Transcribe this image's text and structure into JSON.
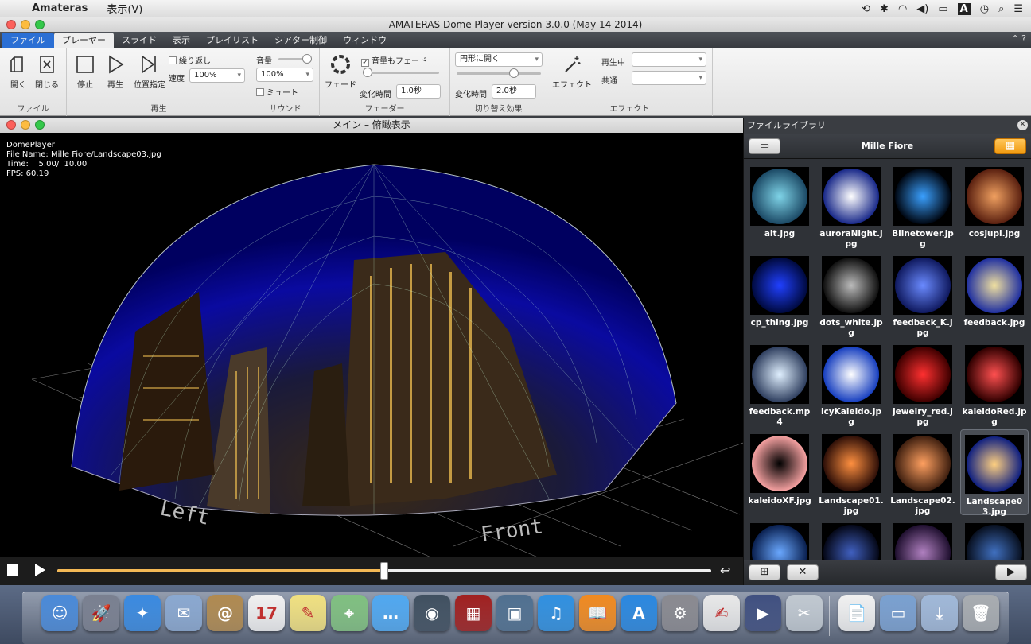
{
  "menubar": {
    "app": "Amateras",
    "menu": "表示(V)",
    "status_icons": [
      "time-machine-icon",
      "bluetooth-icon",
      "wifi-icon",
      "volume-icon",
      "battery-icon",
      "input-source-icon",
      "clock-icon",
      "spotlight-icon",
      "notification-icon"
    ],
    "input_source": "A"
  },
  "window_title": "AMATERAS Dome Player version 3.0.0 (May 14 2014)",
  "tabs": [
    "ファイル",
    "プレーヤー",
    "スライド",
    "表示",
    "プレイリスト",
    "シアター制御",
    "ウィンドウ"
  ],
  "ribbon": {
    "file": {
      "open": "開く",
      "close": "閉じる",
      "label": "ファイル"
    },
    "play": {
      "stop": "停止",
      "play": "再生",
      "position": "位置指定",
      "repeat": "繰り返し",
      "speed_label": "速度",
      "speed_value": "100%",
      "label": "再生"
    },
    "sound": {
      "volume_label": "音量",
      "volume_value": "100%",
      "mute": "ミュート",
      "label": "サウンド"
    },
    "fader": {
      "fade": "フェード",
      "volume_fade": "音量もフェード",
      "time_label": "変化時間",
      "time_value": "1.0秒",
      "label": "フェーダー"
    },
    "transition": {
      "mode": "円形に開く",
      "time_label": "変化時間",
      "time_value": "2.0秒",
      "label": "切り替え効果"
    },
    "effect": {
      "effect": "エフェクト",
      "playing_label": "再生中",
      "common_label": "共通",
      "label": "エフェクト"
    }
  },
  "main_window": {
    "title": "メイン – 俯瞰表示",
    "overlay": "DomePlayer\nFile Name: Mille Fiore/Landscape03.jpg\nTime:    5.00/  10.00\nFPS: 60.19",
    "labels": {
      "left": "Left",
      "front": "Front"
    },
    "progress": 0.5
  },
  "library": {
    "title": "ファイルライブラリ",
    "folder": "Mille Fiore",
    "items": [
      {
        "name": "alt.jpg",
        "colors": [
          "#7fd4e8",
          "#1c4a66"
        ]
      },
      {
        "name": "auroraNight.jpg",
        "colors": [
          "#ffffff",
          "#1a2a8a"
        ]
      },
      {
        "name": "Blinetower.jpg",
        "colors": [
          "#3aa0ff",
          "#000814"
        ]
      },
      {
        "name": "cosjupi.jpg",
        "colors": [
          "#f0a060",
          "#5a2010"
        ]
      },
      {
        "name": "cp_thing.jpg",
        "colors": [
          "#2040ff",
          "#000a40"
        ]
      },
      {
        "name": "dots_white.jpg",
        "colors": [
          "#bbbbbb",
          "#111111"
        ]
      },
      {
        "name": "feedback_K.jpg",
        "colors": [
          "#6a8aff",
          "#101a60"
        ]
      },
      {
        "name": "feedback.jpg",
        "colors": [
          "#f0e0a0",
          "#2030a0"
        ]
      },
      {
        "name": "feedback.mp4",
        "colors": [
          "#e0f0ff",
          "#304060"
        ]
      },
      {
        "name": "icyKaleido.jpg",
        "colors": [
          "#ffffff",
          "#1840c0"
        ]
      },
      {
        "name": "jewelry_red.jpg",
        "colors": [
          "#ff3030",
          "#400000"
        ]
      },
      {
        "name": "kaleidoRed.jpg",
        "colors": [
          "#ff5050",
          "#300000"
        ]
      },
      {
        "name": "kaleidoXF.jpg",
        "colors": [
          "#000000",
          "#f4a0a0"
        ]
      },
      {
        "name": "Landscape01.jpg",
        "colors": [
          "#ff9040",
          "#301008"
        ]
      },
      {
        "name": "Landscape02.jpg",
        "colors": [
          "#ffa060",
          "#402010"
        ]
      },
      {
        "name": "Landscape03.jpg",
        "colors": [
          "#ffd080",
          "#102080"
        ]
      },
      {
        "name": "",
        "colors": [
          "#6aa8ff",
          "#0a2050"
        ]
      },
      {
        "name": "",
        "colors": [
          "#4060c0",
          "#050818"
        ]
      },
      {
        "name": "",
        "colors": [
          "#b080c0",
          "#201030"
        ]
      },
      {
        "name": "",
        "colors": [
          "#4070c0",
          "#081020"
        ]
      }
    ],
    "selected_index": 15
  },
  "dock": [
    {
      "name": "finder-icon",
      "color": "#4a8ad8",
      "glyph": "☺"
    },
    {
      "name": "launchpad-icon",
      "color": "#7a8090",
      "glyph": "🚀"
    },
    {
      "name": "safari-icon",
      "color": "#3a8ae0",
      "glyph": "✦"
    },
    {
      "name": "mail-icon",
      "color": "#8aa8d0",
      "glyph": "✉"
    },
    {
      "name": "contacts-icon",
      "color": "#b08a50",
      "glyph": "@"
    },
    {
      "name": "calendar-icon",
      "color": "#f0f0f0",
      "glyph": "17"
    },
    {
      "name": "notes-icon",
      "color": "#f0e080",
      "glyph": "✎"
    },
    {
      "name": "maps-icon",
      "color": "#80c080",
      "glyph": "⌖"
    },
    {
      "name": "messages-icon",
      "color": "#50a8f0",
      "glyph": "…"
    },
    {
      "name": "facetime-icon",
      "color": "#405060",
      "glyph": "◉"
    },
    {
      "name": "photo-booth-icon",
      "color": "#a02020",
      "glyph": "▦"
    },
    {
      "name": "iphoto-icon",
      "color": "#507090",
      "glyph": "▣"
    },
    {
      "name": "itunes-icon",
      "color": "#3090e0",
      "glyph": "♫"
    },
    {
      "name": "ibooks-icon",
      "color": "#f08a20",
      "glyph": "📖"
    },
    {
      "name": "app-store-icon",
      "color": "#2a88e0",
      "glyph": "A"
    },
    {
      "name": "system-preferences-icon",
      "color": "#8a8a90",
      "glyph": "⚙"
    },
    {
      "name": "textedit-icon",
      "color": "#e8e8e8",
      "glyph": "✍"
    },
    {
      "name": "quicktime-icon",
      "color": "#405080",
      "glyph": "▶"
    },
    {
      "name": "preview-icon",
      "color": "#c0c8d0",
      "glyph": "✂"
    },
    {
      "name": "documents-icon",
      "color": "#f0f0f0",
      "glyph": "📄"
    },
    {
      "name": "applications-folder-icon",
      "color": "#7aa0d0",
      "glyph": "▭"
    },
    {
      "name": "downloads-icon",
      "color": "#a0b8d8",
      "glyph": "⤓"
    },
    {
      "name": "trash-icon",
      "color": "#a8acb0",
      "glyph": "🗑"
    }
  ]
}
